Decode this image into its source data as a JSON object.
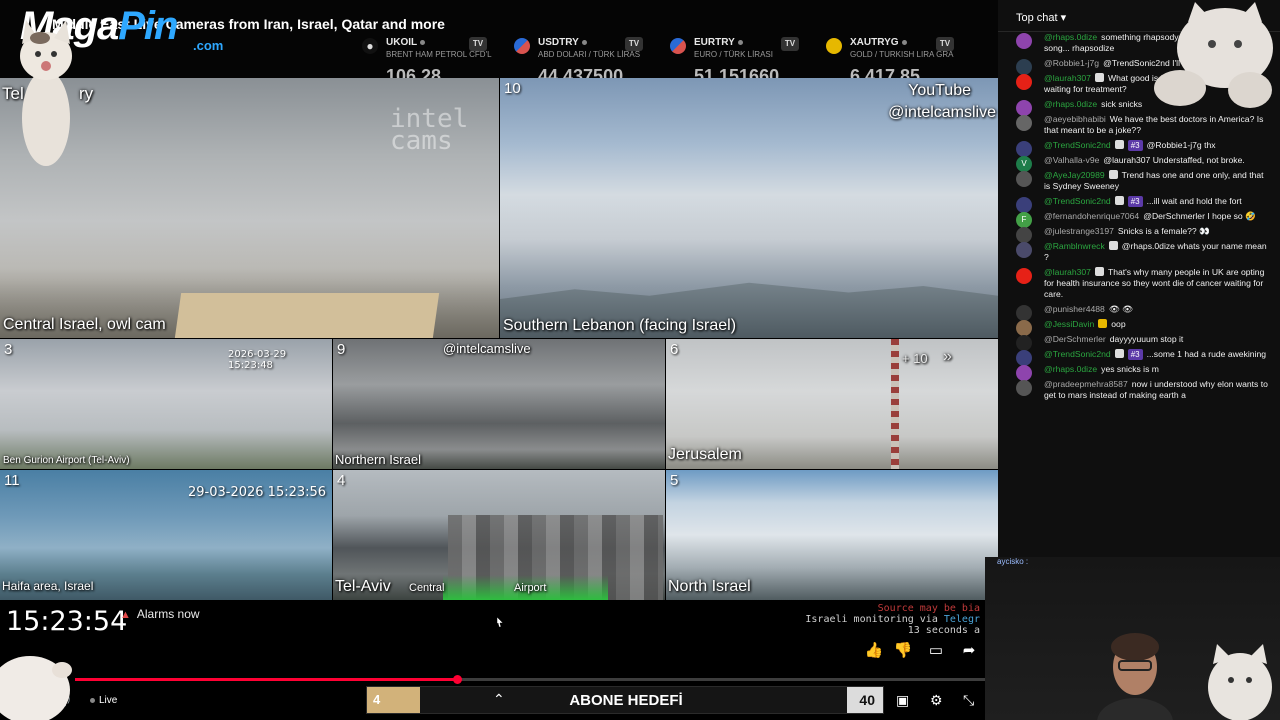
{
  "stream": {
    "title_prefix": "Mi",
    "title_visible": "Middle East Live Cameras from Iran, Israel, Qatar and more",
    "logo_text": "MagaPin",
    "logo_suffix": ".com"
  },
  "tickers": [
    {
      "symbol": "UKOIL",
      "sub": "BRENT HAM PETROL CFD'L",
      "value": "106.28",
      "icon_color": "#cccccc"
    },
    {
      "symbol": "USDTRY",
      "sub": "ABD DOLARI / TÜRK LİRAS",
      "value": "44.437500",
      "icon_color": "#d9534f"
    },
    {
      "symbol": "EURTRY",
      "sub": "EURO / TÜRK LİRASI",
      "value": "51.151660",
      "icon_color": "#2a6ad6"
    },
    {
      "symbol": "XAUTRYG",
      "sub": "GOLD / TURKISH LIRA GRA",
      "value": "6.417.85",
      "icon_color": "#e6b800"
    }
  ],
  "cameras": {
    "central": {
      "label": "Central Israel, owl cam",
      "corner": "Tel",
      "corner_right": "ry",
      "watermark": "intel cams"
    },
    "south": {
      "number": "10",
      "label": "Southern Lebanon (facing Israel)",
      "yt1": "YouTube",
      "yt2": "@intelcamslive"
    },
    "c3": {
      "number": "3",
      "label": "Ben Gurion Airport (Tel-Aviv)",
      "timestamp": "2026-03-29 15:23:48"
    },
    "c9": {
      "number": "9",
      "label": "Northern Israel",
      "handle": "@intelcamslive"
    },
    "c6": {
      "number": "6",
      "label": "Jerusalem",
      "more": "+ 10"
    },
    "c11": {
      "number": "11",
      "label": "Haifa area, Israel",
      "timestamp": "29-03-2026 15:23:56"
    },
    "c4": {
      "number": "4",
      "label": "Tel-Aviv",
      "sub1": "Central",
      "sub2": "Airport"
    },
    "c5": {
      "number": "5",
      "label": "North Israel"
    }
  },
  "overlay": {
    "clock": "15:23:54",
    "alarm": "Alarms now",
    "monitor_line1": "Source may be bia",
    "monitor_line2a": "Israeli monitoring via ",
    "monitor_line2b": "Telegr",
    "monitor_line3": "13 seconds a"
  },
  "player": {
    "live_label": "Live",
    "progress": 0.42,
    "goal": {
      "current": "4",
      "label": "ABONE HEDEFİ",
      "target": "40",
      "fraction": 0.1
    }
  },
  "chat": {
    "header": "Top chat",
    "messages": [
      {
        "author": "@rhaps.0dize",
        "member": true,
        "text": "something rhapsody and I don't like the song... rhapsodize",
        "avatar": "#8e44ad"
      },
      {
        "author": "@Robbie1-j7g",
        "member": false,
        "text": "@TrendSonic2nd I'll take a break",
        "avatar": "#2c3e50"
      },
      {
        "author": "@laurah307",
        "member": true,
        "badge": true,
        "text": "What good is free Healthcare if you die waiting for treatment?",
        "avatar": "#e62117"
      },
      {
        "author": "@rhaps.0dize",
        "member": true,
        "text": "sick snicks",
        "avatar": "#8e44ad"
      },
      {
        "author": "@aeyebibhabibi",
        "member": false,
        "text": "We have the best doctors in America? Is that meant to be a joke??",
        "avatar": "#666666"
      },
      {
        "author": "@TrendSonic2nd",
        "member": true,
        "badge": true,
        "tier": "#3",
        "text": "@Robbie1-j7g thx",
        "avatar": "#3a3f7a"
      },
      {
        "author": "@Valhalla-v9e",
        "member": false,
        "text": "@laurah307 Understaffed, not broke.",
        "avatar": "#1e7d4a",
        "initial": "V"
      },
      {
        "author": "@AyeJay20989",
        "member": true,
        "badge": true,
        "text": "Trend has one and one only, and that is Sydney Sweeney",
        "avatar": "#555555"
      },
      {
        "author": "@TrendSonic2nd",
        "member": true,
        "badge": true,
        "tier": "#3",
        "text": "...ill wait and hold the fort",
        "avatar": "#3a3f7a"
      },
      {
        "author": "@fernandohenrique7064",
        "member": false,
        "text": "@DerSchmerler I hope so 🤣",
        "avatar": "#43a047",
        "initial": "F"
      },
      {
        "author": "@julestrange3197",
        "member": false,
        "text": "Snicks is a female?? 👀",
        "avatar": "#444444"
      },
      {
        "author": "@Ramblnwreck",
        "member": true,
        "badge": true,
        "text": "@rhaps.0dize whats your name mean ?",
        "avatar": "#4a4a6a"
      },
      {
        "author": "@laurah307",
        "member": true,
        "badge": true,
        "text": "That's why many people in UK are opting for health insurance so they wont die of cancer waiting for care.",
        "avatar": "#e62117"
      },
      {
        "author": "@punisher4488",
        "member": false,
        "text": "👁 👁",
        "avatar": "#333333"
      },
      {
        "author": "@JessiDavin",
        "member": true,
        "goldbadge": true,
        "text": "oop",
        "avatar": "#8a6a4a"
      },
      {
        "author": "@DerSchmerler",
        "member": false,
        "text": "dayyyyuuum stop it",
        "avatar": "#222222"
      },
      {
        "author": "@TrendSonic2nd",
        "member": true,
        "badge": true,
        "tier": "#3",
        "text": "...some 1 had a rude awekining",
        "avatar": "#3a3f7a"
      },
      {
        "author": "@rhaps.0dize",
        "member": true,
        "text": "yes snicks is m",
        "avatar": "#8e44ad"
      },
      {
        "author": "@pradeepmehra8587",
        "member": false,
        "text": "now i understood why elon wants to get to mars instead of making earth a",
        "avatar": "#555555"
      }
    ]
  },
  "webcam": {
    "tag": "aycisko :"
  }
}
